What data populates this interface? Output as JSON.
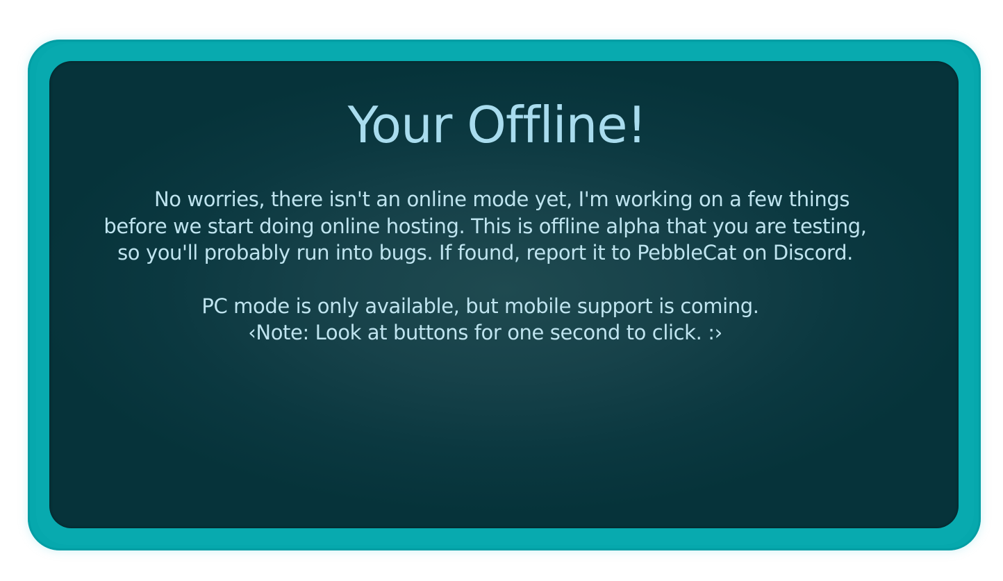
{
  "dialog": {
    "title": "Your Offline!",
    "message": "No worries, there isn't an online mode yet, I'm working on a few things before we start doing online hosting. This is offline alpha that you are testing, so you'll probably run into bugs. If found, report it to PebbleCat on Discord.",
    "platform_notice": "PC mode is only available, but mobile support is coming.",
    "hint": "‹Note: Look at buttons for one second to click. :›"
  },
  "colors": {
    "frame": "#06a8ad",
    "panel": "#0b3840",
    "title_text": "#a9dcee",
    "body_text": "#bfe4ef"
  }
}
